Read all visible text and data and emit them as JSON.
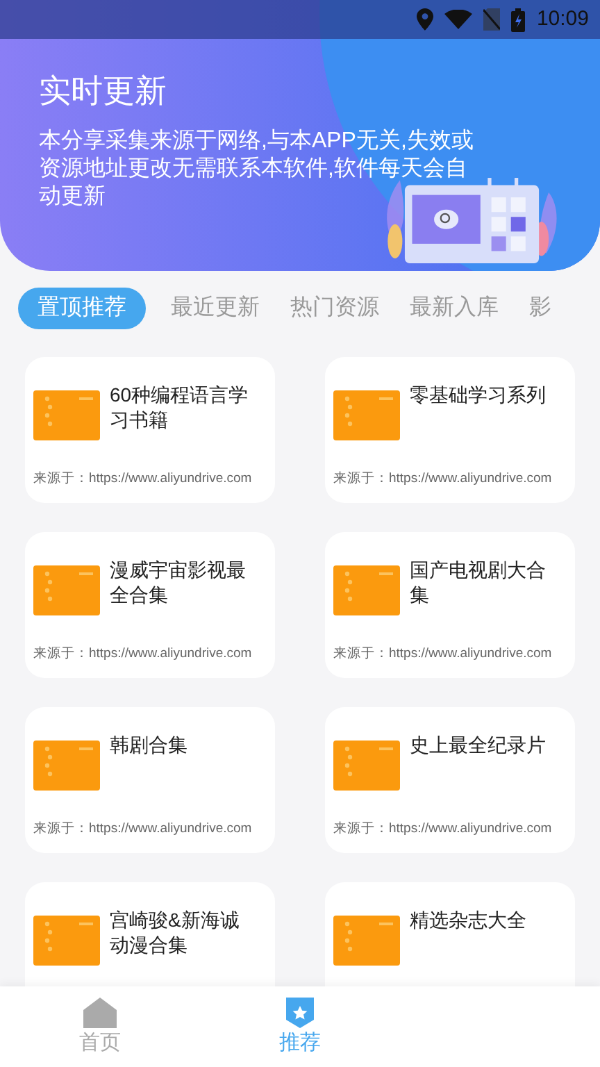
{
  "status_bar": {
    "time": "10:09"
  },
  "banner": {
    "title": "实时更新",
    "description": "本分享采集来源于网络,与本APP无关,失效或资源地址更改无需联系本软件,软件每天会自动更新"
  },
  "tabs": [
    {
      "label": "置顶推荐",
      "selected": true
    },
    {
      "label": "最近更新",
      "selected": false
    },
    {
      "label": "热门资源",
      "selected": false
    },
    {
      "label": "最新入库",
      "selected": false
    },
    {
      "label": "影",
      "selected": false
    }
  ],
  "items": [
    {
      "title": "60种编程语言学习书籍",
      "source": "来源于：https://www.aliyundrive.com"
    },
    {
      "title": "零基础学习系列",
      "source": "来源于：https://www.aliyundrive.com"
    },
    {
      "title": "漫威宇宙影视最全合集",
      "source": "来源于：https://www.aliyundrive.com"
    },
    {
      "title": "国产电视剧大合集",
      "source": "来源于：https://www.aliyundrive.com"
    },
    {
      "title": "韩剧合集",
      "source": "来源于：https://www.aliyundrive.com"
    },
    {
      "title": "史上最全纪录片",
      "source": "来源于：https://www.aliyundrive.com"
    },
    {
      "title": "宫崎骏&新海诚动漫合集"
    },
    {
      "title": "精选杂志大全"
    }
  ],
  "bottom_nav": [
    {
      "label": "首页",
      "kind": "home",
      "selected": false
    },
    {
      "label": "推荐",
      "kind": "star",
      "selected": true
    }
  ]
}
